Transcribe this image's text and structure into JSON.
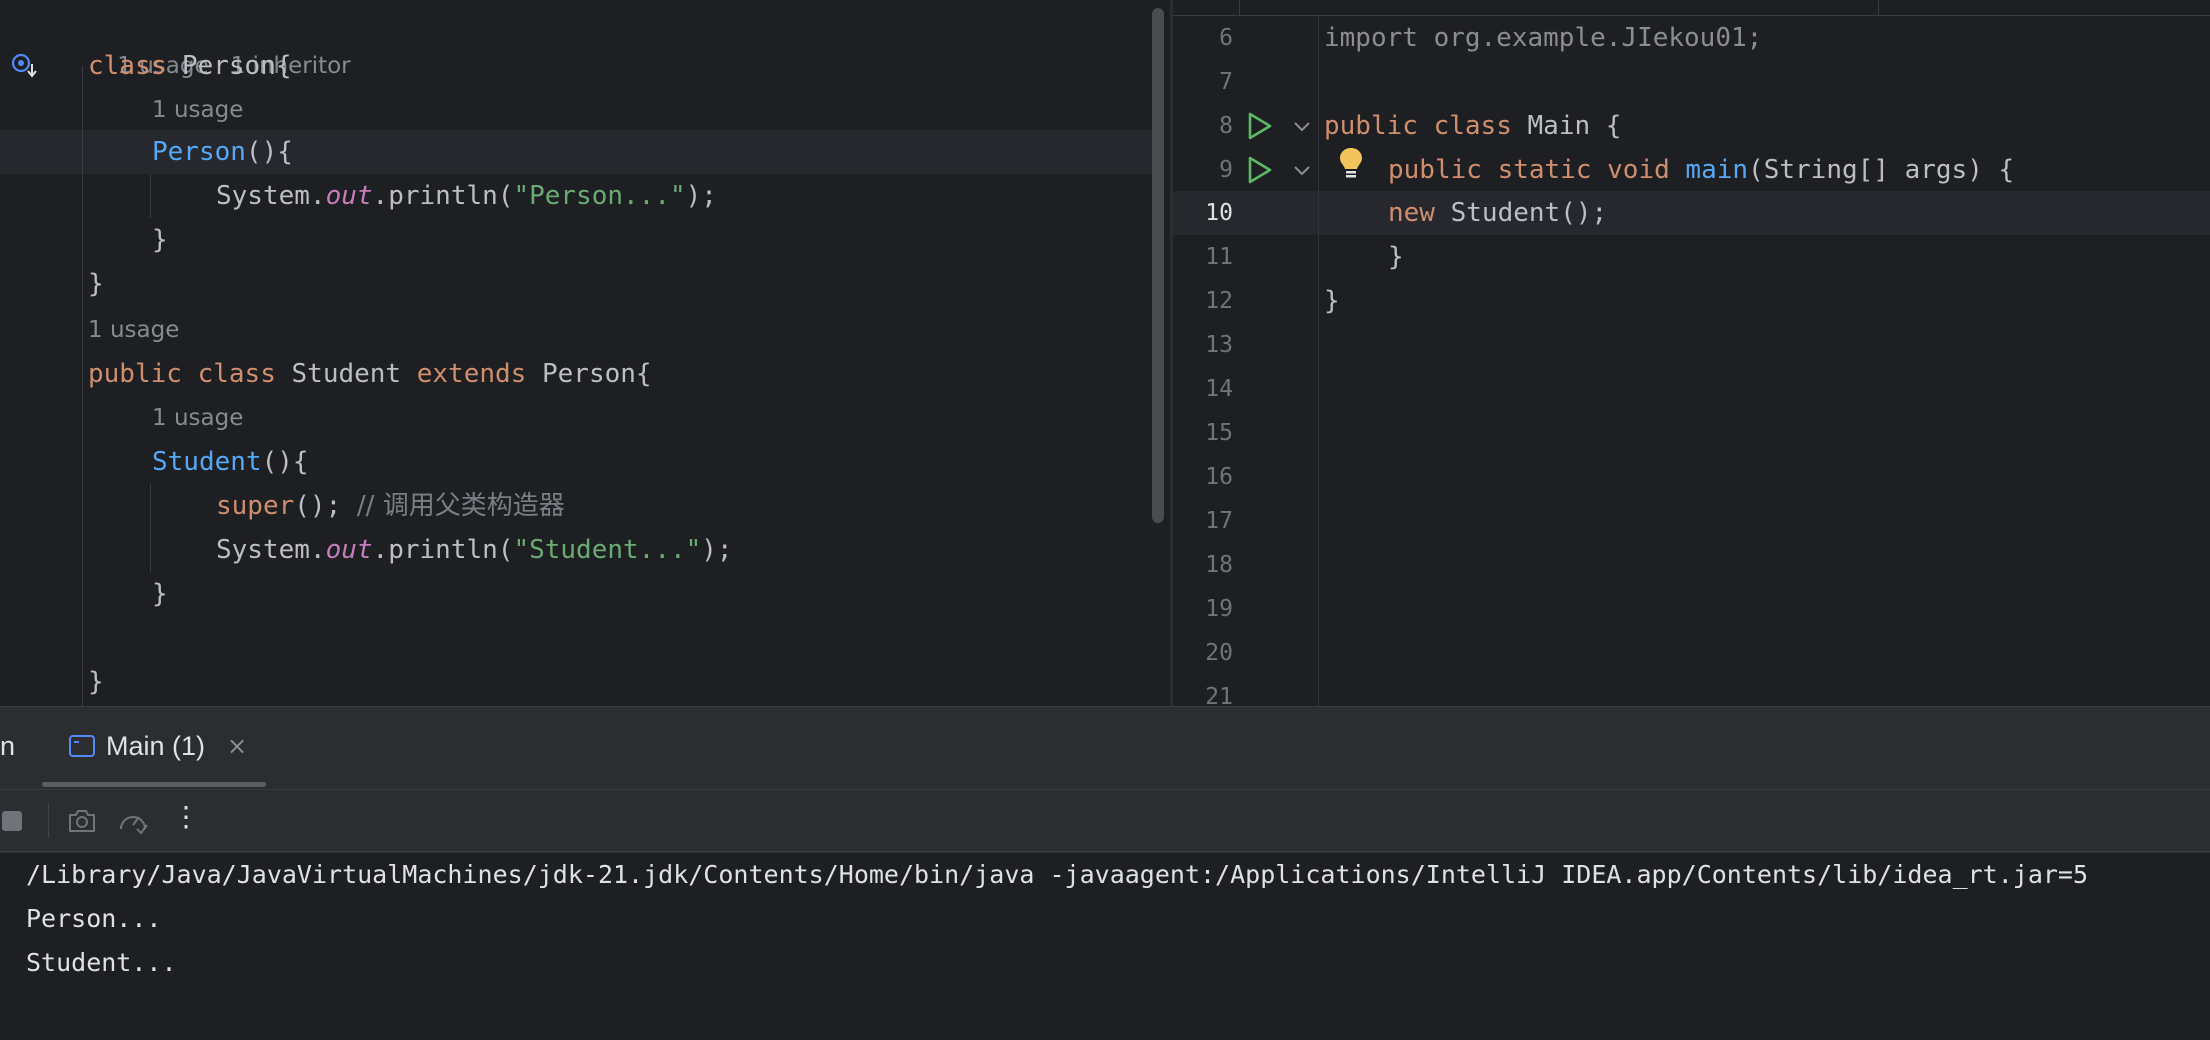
{
  "left_editor": {
    "hints": {
      "person_class": [
        "1 usage",
        "1 inheritor"
      ],
      "person_ctor": "1 usage",
      "student_class": "1 usage",
      "student_ctor": "1 usage"
    },
    "code": {
      "l1_kw": "class",
      "l1_rest": " Person{",
      "l2_name": "Person",
      "l2_rest": "(){",
      "l3_a": "System.",
      "l3_field": "out",
      "l3_b": ".println(",
      "l3_str": "\"Person...\"",
      "l3_c": ");",
      "l4": "}",
      "l5": "}",
      "l6_kw1": "public",
      "l6_kw2": "class",
      "l6_name": " Student ",
      "l6_kw3": "extends",
      "l6_rest": " Person{",
      "l7_name": "Student",
      "l7_rest": "(){",
      "l8_kw": "super",
      "l8_rest": "(); ",
      "l8_comment": "// 调用父类构造器",
      "l9_a": "System.",
      "l9_field": "out",
      "l9_b": ".println(",
      "l9_str": "\"Student...\"",
      "l9_c": ");",
      "l10": "}",
      "l11": "}"
    }
  },
  "right_editor": {
    "line_numbers": [
      "6",
      "7",
      "8",
      "9",
      "10",
      "11",
      "12",
      "13",
      "14",
      "15",
      "16",
      "17",
      "18",
      "19",
      "20",
      "21"
    ],
    "current_line": "10",
    "code": {
      "r6": "import org.example.JIekou01;",
      "r8_kw1": "public",
      "r8_kw2": "class",
      "r8_rest": " Main {",
      "r9_kw": "public static void",
      "r9_fn": "main",
      "r9_rest": "(String[] args) {",
      "r10_kw": "new",
      "r10_rest": " Student();",
      "r11": "}",
      "r12": "}"
    }
  },
  "tool_window": {
    "left_tab_fragment": "n",
    "run_tab_label": "Main (1)",
    "close_glyph": "×",
    "more_glyph": "⋮"
  },
  "console": {
    "lines": [
      "/Library/Java/JavaVirtualMachines/jdk-21.jdk/Contents/Home/bin/java -javaagent:/Applications/IntelliJ IDEA.app/Contents/lib/idea_rt.jar=5",
      "Person...",
      "Student..."
    ]
  },
  "colors": {
    "editor_bg": "#1e1f22",
    "panel_bg": "#2b2d30",
    "keyword": "#cf8e6d",
    "function": "#56a8f5",
    "string": "#6aab73",
    "static_field": "#c77dbb",
    "run_green": "#5fb865",
    "bulb_yellow": "#f2c55c"
  }
}
